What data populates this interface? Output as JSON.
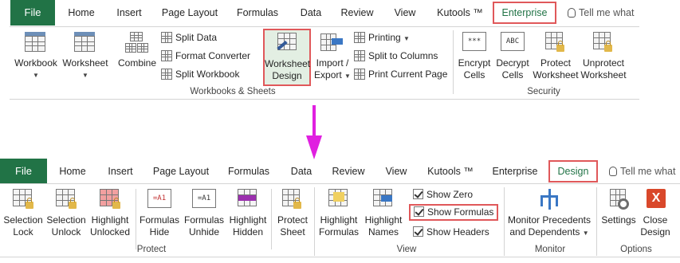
{
  "top": {
    "tabs": [
      "File",
      "Home",
      "Insert",
      "Page Layout",
      "Formulas",
      "Data",
      "Review",
      "View",
      "Kutools ™",
      "Enterprise"
    ],
    "tell_me": "Tell me what",
    "groups": {
      "workbooks_sheets": "Workbooks & Sheets",
      "security": "Security"
    },
    "buttons": {
      "workbook": "Workbook",
      "worksheet": "Worksheet",
      "combine": "Combine",
      "split_data": "Split Data",
      "format_converter": "Format Converter",
      "split_workbook": "Split Workbook",
      "worksheet_design_1": "Worksheet",
      "worksheet_design_2": "Design",
      "import_export_1": "Import /",
      "import_export_2": "Export",
      "printing": "Printing",
      "split_to_columns": "Split to Columns",
      "print_current_page": "Print Current Page",
      "encrypt_1": "Encrypt",
      "encrypt_2": "Cells",
      "decrypt_1": "Decrypt",
      "decrypt_2": "Cells",
      "protect_1": "Protect",
      "protect_2": "Worksheet",
      "unprotect_1": "Unprotect",
      "unprotect_2": "Worksheet"
    },
    "icon_text": {
      "encrypt": "***",
      "decrypt": "ABC"
    }
  },
  "bottom": {
    "tabs": [
      "File",
      "Home",
      "Insert",
      "Page Layout",
      "Formulas",
      "Data",
      "Review",
      "View",
      "Kutools ™",
      "Enterprise",
      "Design"
    ],
    "tell_me": "Tell me what",
    "groups": {
      "protect": "Protect",
      "view": "View",
      "monitor": "Monitor",
      "options": "Options"
    },
    "buttons": {
      "selection_lock_1": "Selection",
      "selection_lock_2": "Lock",
      "selection_unlock_1": "Selection",
      "selection_unlock_2": "Unlock",
      "highlight_unlocked_1": "Highlight",
      "highlight_unlocked_2": "Unlocked",
      "formulas_hide_1": "Formulas",
      "formulas_hide_2": "Hide",
      "formulas_unhide_1": "Formulas",
      "formulas_unhide_2": "Unhide",
      "highlight_hidden_1": "Highlight",
      "highlight_hidden_2": "Hidden",
      "protect_sheet_1": "Protect",
      "protect_sheet_2": "Sheet",
      "highlight_formulas_1": "Highlight",
      "highlight_formulas_2": "Formulas",
      "highlight_names_1": "Highlight",
      "highlight_names_2": "Names",
      "show_zero": "Show Zero",
      "show_formulas": "Show Formulas",
      "show_headers": "Show Headers",
      "monitor_1": "Monitor Precedents",
      "monitor_2": "and Dependents",
      "settings": "Settings",
      "close_1": "Close",
      "close_2": "Design"
    },
    "checkboxes": {
      "show_zero": true,
      "show_formulas": true,
      "show_headers": true
    },
    "icon_text": {
      "formulas_hide": "=A1",
      "formulas_unhide": "=A1",
      "close": "X"
    }
  },
  "colors": {
    "file_tab": "#217346",
    "highlight_border": "#e0585a",
    "arrow": "#e020e0"
  }
}
